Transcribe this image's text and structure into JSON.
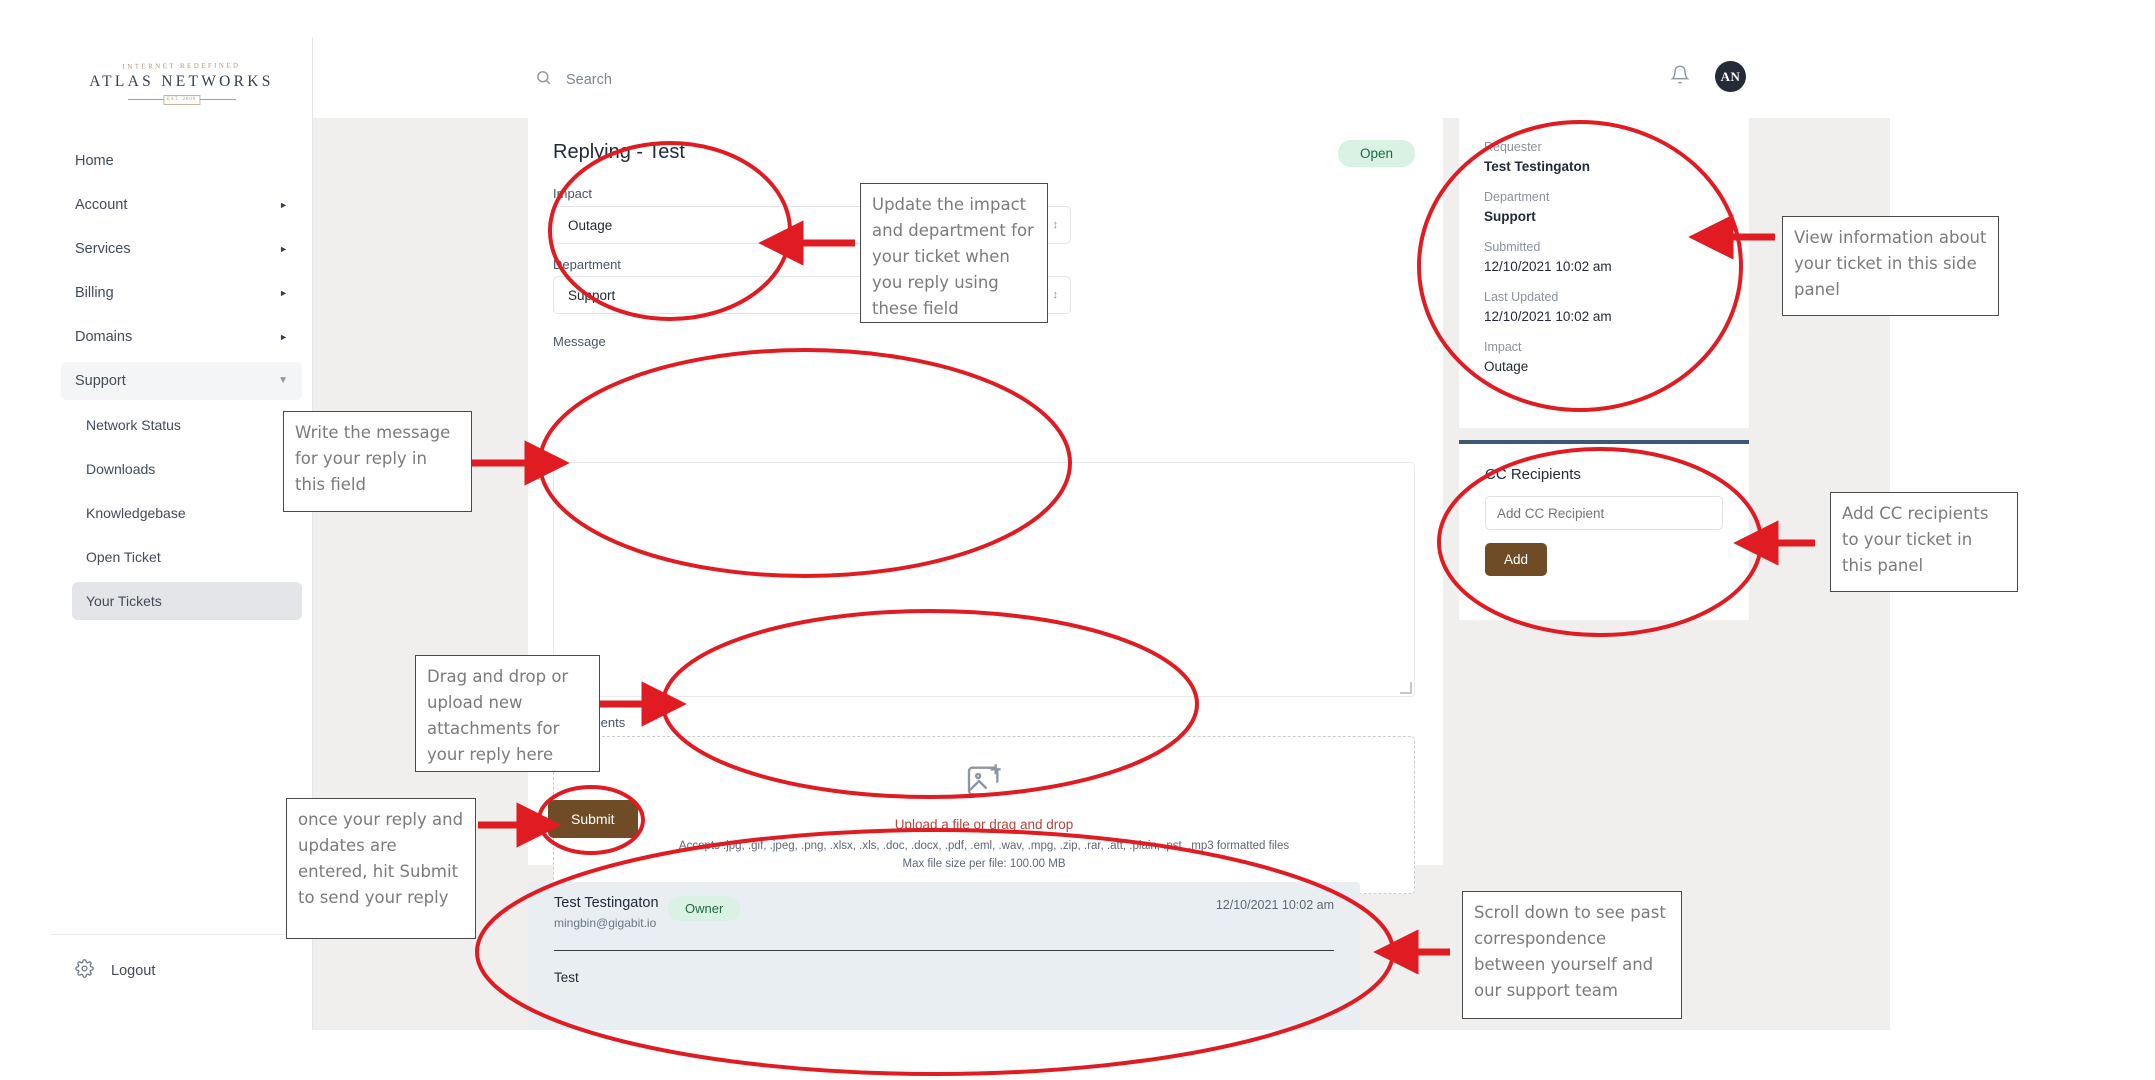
{
  "brand": {
    "logo_tagline": "INTERNET REDEFINED",
    "logo_name": "ATLAS NETWORKS",
    "logo_est": "EST. 2006"
  },
  "sidebar": {
    "items": [
      {
        "label": "Home",
        "caret": "",
        "active": false
      },
      {
        "label": "Account",
        "caret": "right",
        "active": false
      },
      {
        "label": "Services",
        "caret": "right",
        "active": false
      },
      {
        "label": "Billing",
        "caret": "right",
        "active": false
      },
      {
        "label": "Domains",
        "caret": "right",
        "active": false
      },
      {
        "label": "Support",
        "caret": "down",
        "active": true
      }
    ],
    "sub_items": [
      {
        "label": "Network Status",
        "active": false
      },
      {
        "label": "Downloads",
        "active": false
      },
      {
        "label": "Knowledgebase",
        "active": false
      },
      {
        "label": "Open Ticket",
        "active": false
      },
      {
        "label": "Your Tickets",
        "active": true
      }
    ],
    "logout_label": "Logout"
  },
  "topbar": {
    "search_placeholder": "Search",
    "avatar_initials": "AN"
  },
  "form": {
    "title": "Replying - Test",
    "status_badge": "Open",
    "impact_label": "Impact",
    "impact_value": "Outage",
    "department_label": "Department",
    "department_value": "Support",
    "message_label": "Message",
    "message_value": "",
    "attachments_label": "Attachments",
    "dropzone_title": "Upload a file or drag and drop",
    "dropzone_accepts": "Accepts .jpg, .gif, .jpeg, .png, .xlsx, .xls, .doc, .docx, .pdf, .eml, .wav, .mpg, .zip, .rar, .att, .plain, .pst, .mp3 formatted files",
    "dropzone_maxsize": "Max file size per file: 100.00 MB",
    "submit_label": "Submit"
  },
  "ticket_info": {
    "requester_label": "Requester",
    "requester_value": "Test Testingaton",
    "department_label": "Department",
    "department_value": "Support",
    "submitted_label": "Submitted",
    "submitted_value": "12/10/2021 10:02 am",
    "updated_label": "Last Updated",
    "updated_value": "12/10/2021 10:02 am",
    "impact_label": "Impact",
    "impact_value": "Outage"
  },
  "cc_panel": {
    "title": "CC Recipients",
    "input_placeholder": "Add CC Recipient",
    "input_value": "",
    "add_label": "Add"
  },
  "conversation": {
    "author": "Test Testingaton",
    "email": "mingbin@gigabit.io",
    "role_badge": "Owner",
    "timestamp": "12/10/2021 10:02 am",
    "body": "Test"
  },
  "annotations": {
    "accent_color": "#e01b22",
    "callouts": [
      {
        "text": "Update the impact and department for your ticket when you reply using these field"
      },
      {
        "text": "Write the message for your reply in this field"
      },
      {
        "text": "Drag and drop or upload new attachments for your reply here"
      },
      {
        "text": "once your reply and updates are entered, hit Submit to send your reply"
      },
      {
        "text": "View information about your ticket in this side panel"
      },
      {
        "text": "Add CC recipients to your ticket in this panel"
      },
      {
        "text": "Scroll down to see past correspondence between yourself and our support team"
      }
    ]
  }
}
